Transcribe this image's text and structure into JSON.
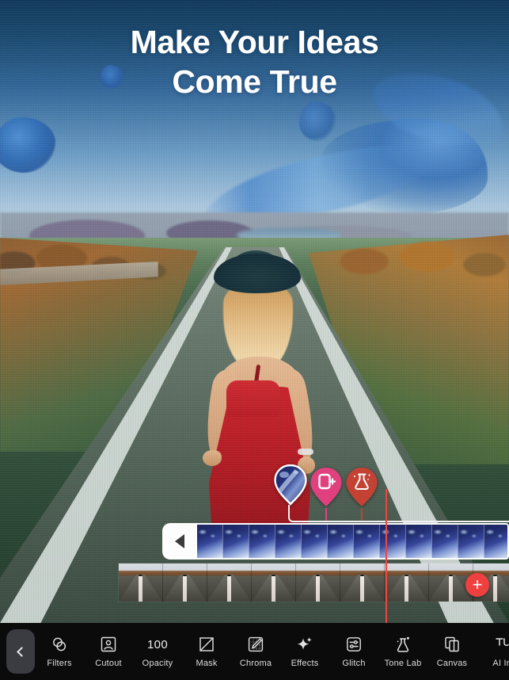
{
  "canvas": {
    "headline": "Make Your Ideas\nCome True",
    "headline_line1": "Make Your Ideas",
    "headline_line2": "Come True",
    "scene_alt": "Woman in red dress and black hat walking down a country road with blue ink splatters in the sky"
  },
  "markers": [
    {
      "name": "layer-thumbnail-pin",
      "type": "thumbnail",
      "color": "#ffffff",
      "selected": true,
      "icon": "ink-thumbnail"
    },
    {
      "name": "cutout-pin",
      "type": "tool",
      "color": "#e0417e",
      "selected": false,
      "icon": "add-layer-icon"
    },
    {
      "name": "tone-lab-pin",
      "type": "tool",
      "color": "#c34234",
      "selected": false,
      "icon": "flask-icon"
    }
  ],
  "timeline": {
    "playhead_color": "#f2443d",
    "track1": {
      "name": "ink-overlay-track",
      "handle_icon": "collapse-left-arrow",
      "frame_count": 14,
      "selected": true
    },
    "track2": {
      "name": "base-video-track",
      "frame_count": 9,
      "selected": false
    },
    "add_button_label": "+"
  },
  "toolbar": {
    "back_label": "",
    "back_icon": "chevron-left-icon",
    "items": [
      {
        "label": "Filters",
        "icon": "filters-icon",
        "value": null
      },
      {
        "label": "Cutout",
        "icon": "cutout-icon",
        "value": null
      },
      {
        "label": "Opacity",
        "icon": "opacity-value",
        "value": "100"
      },
      {
        "label": "Mask",
        "icon": "mask-icon",
        "value": null
      },
      {
        "label": "Chroma",
        "icon": "chroma-icon",
        "value": null
      },
      {
        "label": "Effects",
        "icon": "effects-icon",
        "value": null
      },
      {
        "label": "Glitch",
        "icon": "glitch-icon",
        "value": null
      },
      {
        "label": "Tone Lab",
        "icon": "tone-lab-icon",
        "value": null
      },
      {
        "label": "Canvas",
        "icon": "canvas-icon",
        "value": null
      },
      {
        "label": "AI Ir",
        "icon": "ai-icon",
        "value": null
      }
    ]
  },
  "colors": {
    "background": "#0b0b0b",
    "accent_red": "#ef4040",
    "accent_pink": "#e0417e",
    "accent_rust": "#c34234",
    "playhead": "#f2443d",
    "text": "#e2e2e2"
  }
}
